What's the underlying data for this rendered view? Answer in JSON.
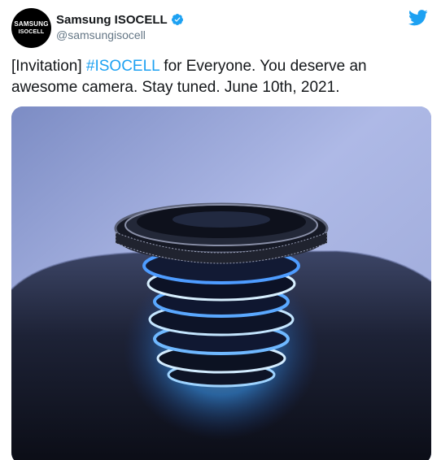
{
  "author": {
    "avatar_line1": "SAMSUNG",
    "avatar_line2": "ISOCELL",
    "display_name": "Samsung ISOCELL",
    "handle": "@samsungisocell",
    "verified": true
  },
  "tweet": {
    "text_before": "[Invitation] ",
    "hashtag": "#ISOCELL",
    "text_after": " for Everyone. You deserve an awesome camera. Stay tuned. June 10th, 2021."
  },
  "colors": {
    "accent": "#1da1f2",
    "text": "#14171a",
    "muted": "#657786"
  },
  "icons": {
    "verified": "verified-badge-icon",
    "platform": "twitter-bird-icon"
  }
}
